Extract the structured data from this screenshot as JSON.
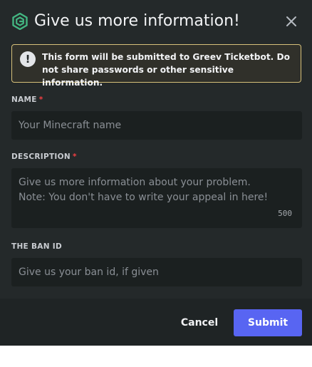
{
  "modal": {
    "title": "Give us more information!",
    "logo_icon": "ticketbot-logo-icon",
    "close_icon": "close-icon"
  },
  "notice": {
    "icon": "exclamation-icon",
    "text": "This form will be submitted to Greev Ticketbot. Do not share passwords or other sensitive information.",
    "border_color": "#d6c07a"
  },
  "fields": {
    "name": {
      "label": "NAME",
      "required_mark": "*",
      "placeholder": "Your Minecraft name"
    },
    "description": {
      "label": "DESCRIPTION",
      "required_mark": "*",
      "placeholder_line1": "Give us more information about your problem.",
      "placeholder_line2": "Note: You don't have to write your appeal in here!",
      "char_limit": "500"
    },
    "ban_id": {
      "label": "THE BAN ID",
      "placeholder": "Give us your ban id, if given"
    }
  },
  "footer": {
    "cancel_label": "Cancel",
    "submit_label": "Submit",
    "submit_color": "#5865f2"
  }
}
